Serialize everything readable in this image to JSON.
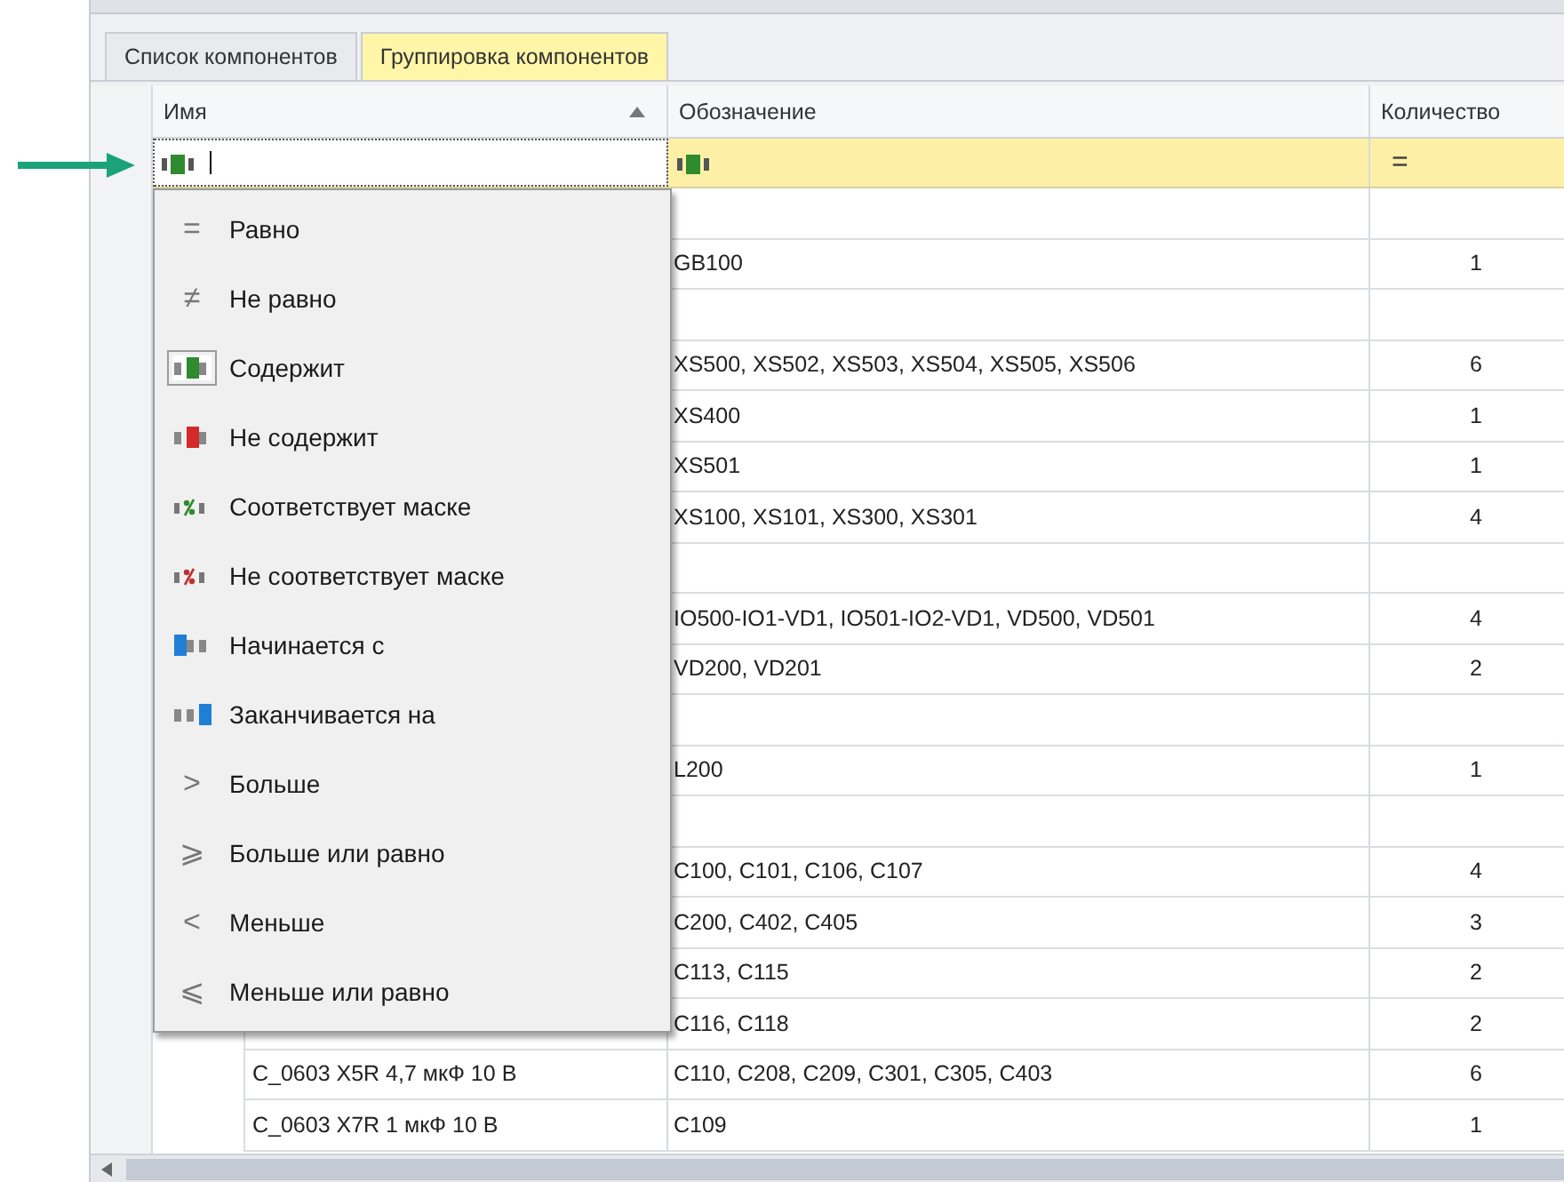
{
  "tabs": [
    {
      "label": "Список компонентов",
      "selected": false
    },
    {
      "label": "Группировка компонентов",
      "selected": true
    }
  ],
  "columns": [
    {
      "title": "Имя",
      "sorted_ascending": true
    },
    {
      "title": "Обозначение"
    },
    {
      "title": "Количество"
    }
  ],
  "filter_row": {
    "quantity_symbol": "="
  },
  "rows": [
    {},
    {
      "designation": "GB100",
      "quantity": "1"
    },
    {},
    {
      "designation": "XS500, XS502, XS503, XS504, XS505, XS506",
      "quantity": "6"
    },
    {
      "designation": "XS400",
      "quantity": "1"
    },
    {
      "designation": "XS501",
      "quantity": "1"
    },
    {
      "designation": "XS100, XS101, XS300, XS301",
      "quantity": "4"
    },
    {},
    {
      "designation": "IO500-IO1-VD1, IO501-IO2-VD1, VD500, VD501",
      "quantity": "4"
    },
    {
      "designation": "VD200, VD201",
      "quantity": "2"
    },
    {},
    {
      "designation": "L200",
      "quantity": "1"
    },
    {},
    {
      "designation": "C100, C101, C106, C107",
      "quantity": "4"
    },
    {
      "designation": "C200, C402, C405",
      "quantity": "3"
    },
    {
      "designation": "C113, C115",
      "quantity": "2"
    },
    {
      "designation": "C116, C118",
      "quantity": "2"
    },
    {
      "name": "C_0603 X5R 4,7 мкФ 10 В",
      "designation": "C110, C208, C209, C301, C305, C403",
      "quantity": "6"
    },
    {
      "name": "C_0603 X7R 1 мкФ 10 В",
      "designation": "C109",
      "quantity": "1"
    }
  ],
  "filter_menu": [
    {
      "kind": "symbol",
      "symbol": "=",
      "label": "Равно",
      "selected": false
    },
    {
      "kind": "symbol",
      "symbol": "≠",
      "label": "Не равно",
      "selected": false
    },
    {
      "kind": "contains",
      "label": "Содержит",
      "selected": true
    },
    {
      "kind": "not-contains",
      "label": "Не содержит",
      "selected": false
    },
    {
      "kind": "like",
      "label": "Соответствует маске",
      "selected": false
    },
    {
      "kind": "not-like",
      "label": "Не соответствует маске",
      "selected": false
    },
    {
      "kind": "begins",
      "label": "Начинается с",
      "selected": false
    },
    {
      "kind": "ends",
      "label": "Заканчивается на",
      "selected": false
    },
    {
      "kind": "symbol",
      "symbol": ">",
      "label": "Больше",
      "selected": false
    },
    {
      "kind": "symbol",
      "symbol": "⩾",
      "label": "Больше или равно",
      "selected": false
    },
    {
      "kind": "symbol",
      "symbol": "<",
      "label": "Меньше",
      "selected": false
    },
    {
      "kind": "symbol",
      "symbol": "⩽",
      "label": "Меньше или равно",
      "selected": false
    }
  ]
}
